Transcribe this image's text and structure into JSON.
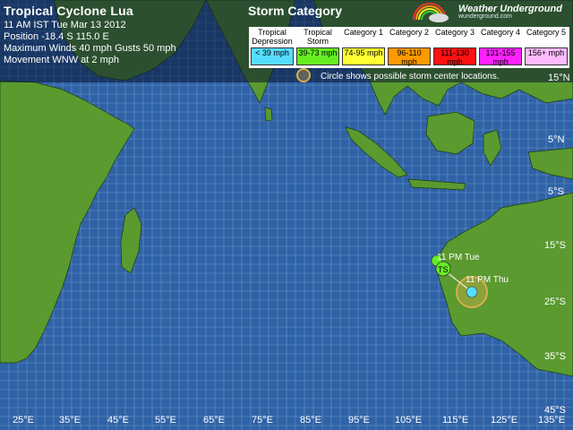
{
  "header": {
    "title": "Tropical Cyclone Lua",
    "time": "11 AM IST Tue Mar 13 2012",
    "position": "Position -18.4 S 115.0 E",
    "winds": "Maximum Winds  40 mph  Gusts  50 mph",
    "movement": "Movement WNW at 2 mph"
  },
  "legend": {
    "title": "Storm Category",
    "categories": [
      {
        "name": "Tropical Depression",
        "range": "< 39 mph",
        "color": "#55ddff"
      },
      {
        "name": "Tropical Storm",
        "range": "39-73 mph",
        "color": "#66ee22"
      },
      {
        "name": "Category 1",
        "range": "74-95 mph",
        "color": "#ffff33"
      },
      {
        "name": "Category 2",
        "range": "96-110 mph",
        "color": "#ff9900"
      },
      {
        "name": "Category 3",
        "range": "111-130 mph",
        "color": "#ff1111"
      },
      {
        "name": "Category 4",
        "range": "131-155 mph",
        "color": "#ff22ff"
      },
      {
        "name": "Category 5",
        "range": "156+ mph",
        "color": "#ffbbff"
      }
    ],
    "circle_note": "Circle shows possible storm center locations."
  },
  "logo": {
    "name": "Weather Underground",
    "sub": "wunderground.com"
  },
  "lat_labels": [
    "15°N",
    "5°N",
    "5°S",
    "15°S",
    "25°S",
    "35°S",
    "45°S"
  ],
  "lon_labels": [
    "25°E",
    "35°E",
    "45°E",
    "55°E",
    "65°E",
    "75°E",
    "85°E",
    "95°E",
    "105°E",
    "115°E",
    "125°E",
    "135°E"
  ],
  "track": {
    "current_label": "TS",
    "points": [
      {
        "label": "11 PM Tue",
        "category": "Tropical Storm"
      },
      {
        "label": "11 PM Thu",
        "category": "Tropical Depression"
      }
    ]
  },
  "colors": {
    "ocean": "#2f62a6",
    "land": "#5a9a2f",
    "grid": "#7aa0d0"
  }
}
